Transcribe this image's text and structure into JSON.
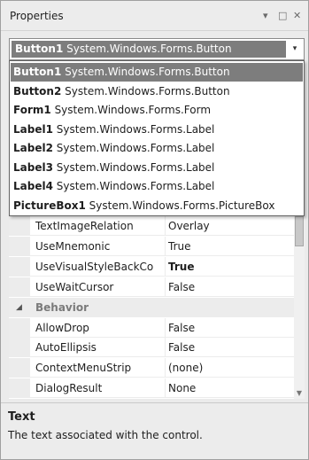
{
  "panel": {
    "title": "Properties",
    "pin_glyph": "▾",
    "maximize_glyph": "□",
    "close_glyph": "✕"
  },
  "selector": {
    "selected_name": "Button1",
    "selected_type": "System.Windows.Forms.Button",
    "arrow_glyph": "▾"
  },
  "dropdown": {
    "items": [
      {
        "name": "Button1",
        "type": "System.Windows.Forms.Button",
        "active": true
      },
      {
        "name": "Button2",
        "type": "System.Windows.Forms.Button",
        "active": false
      },
      {
        "name": "Form1",
        "type": "System.Windows.Forms.Form",
        "active": false
      },
      {
        "name": "Label1",
        "type": "System.Windows.Forms.Label",
        "active": false
      },
      {
        "name": "Label2",
        "type": "System.Windows.Forms.Label",
        "active": false
      },
      {
        "name": "Label3",
        "type": "System.Windows.Forms.Label",
        "active": false
      },
      {
        "name": "Label4",
        "type": "System.Windows.Forms.Label",
        "active": false
      },
      {
        "name": "PictureBox1",
        "type": "System.Windows.Forms.PictureBox",
        "active": false
      }
    ]
  },
  "grid": {
    "rows": [
      {
        "kind": "prop",
        "name": "TextImageRelation",
        "value": "Overlay",
        "bold": false
      },
      {
        "kind": "prop",
        "name": "UseMnemonic",
        "value": "True",
        "bold": false
      },
      {
        "kind": "prop",
        "name": "UseVisualStyleBackCo",
        "value": "True",
        "bold": true
      },
      {
        "kind": "prop",
        "name": "UseWaitCursor",
        "value": "False",
        "bold": false
      },
      {
        "kind": "category",
        "name": "Behavior",
        "glyph": "◢"
      },
      {
        "kind": "prop",
        "name": "AllowDrop",
        "value": "False",
        "bold": false
      },
      {
        "kind": "prop",
        "name": "AutoEllipsis",
        "value": "False",
        "bold": false
      },
      {
        "kind": "prop",
        "name": "ContextMenuStrip",
        "value": "(none)",
        "bold": false
      },
      {
        "kind": "prop",
        "name": "DialogResult",
        "value": "None",
        "bold": false
      }
    ]
  },
  "scrollbar": {
    "down_glyph": "▼"
  },
  "description": {
    "title": "Text",
    "text": "The text associated with the control."
  },
  "colors": {
    "selection_bg": "#7d7d7d",
    "gutter_bg": "#ececec",
    "category_text": "#7a7a7a"
  }
}
